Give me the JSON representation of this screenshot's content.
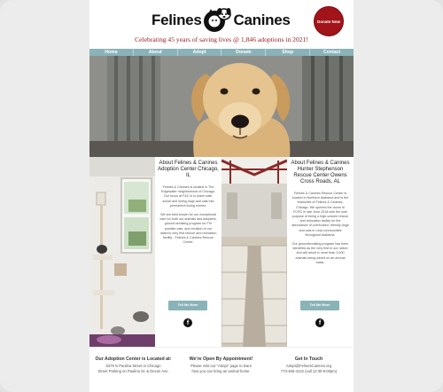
{
  "header": {
    "logo_left": "Felines",
    "logo_amp": "&",
    "logo_right": "Canines",
    "donate_label": "Donate Now",
    "tagline": "Celebrating 45 years of saving lives @ 1,846 adoptions in 2021!"
  },
  "nav": {
    "items": [
      "Home",
      "About",
      "Adopt",
      "Donate",
      "Shop",
      "Contact"
    ]
  },
  "about_chicago": {
    "title": "About Felines & Canines Adoption Center Chicago, IL",
    "para1": "Felines & Canines is located in The Edgewater neighborhood of Chicago. Our focus at F&C is to place safe, social and loving dogs and cats into permanent loving homes.",
    "para2": "We are best known for our exceptional care for both our animals and adopters, ground breaking program for FIV positive cats, and creation of our nation's very first rescue and relocation facility - Felines & Canines Rescue Center.",
    "button": "Tell Me More",
    "social_icon": "facebook-icon"
  },
  "about_alabama": {
    "title": "About Felines & Canines Hunter Stephenson Rescue Center Owens Cross Roads, AL",
    "para1": "Felines & Canines Rescue Center is located in Northern Alabama and is the brainchild of Felines & Canines, Chicago. We opened the doors to FCRC in late June 2018 with the sole purpose of being a high-volume rescue and relocation facility for the abundance of overlooked, friendly dogs and cats in rural communities throughout Alabama.",
    "para2": "Our groundbreaking program has been identified as the very first in our nation and will result in more than 3,000 animals being saved on an annual basis.",
    "button": "Tell Me More",
    "social_icon": "facebook-icon"
  },
  "footer": {
    "col1_title": "Our Adoption Center is Located at:",
    "col1_line1": "6379 N Paulina Street in Chicago",
    "col1_line2": "Street Parking on Paulina St. & Devon Ave.",
    "col2_title": "We're Open By Appointment!",
    "col2_line1": "Please visit our \"Adopt\" page to learn",
    "col2_line2": "how you can bring an animal home.",
    "col3_title": "Get In Touch",
    "col3_line1": "Adopt@FelinesCanines.org",
    "col3_line2": "773-465-4132 (call 12:30-6:00pm)"
  },
  "colors": {
    "accent_red": "#a0141a",
    "nav_teal": "#8ab3b8"
  }
}
